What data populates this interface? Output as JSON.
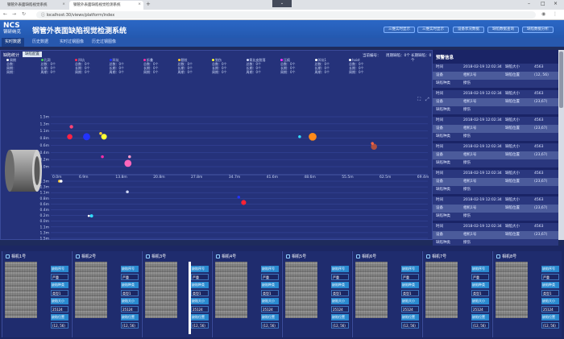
{
  "browser": {
    "tabs": [
      {
        "title": "钢管外表面缺陷视觉系统",
        "active": false
      },
      {
        "title": "钢管外表面缺陷视觉检测系统",
        "active": true
      }
    ],
    "url": "localhost:30/views/platform/index"
  },
  "app": {
    "logo_main": "NCS",
    "logo_sub": "钢研纳克",
    "title": "钢管外表面缺陷视觉检测系统",
    "header_buttons": [
      "三维实时显示",
      "三维实时显示",
      "设备状况数据",
      "缺陷数据查询",
      "缺陷数据分析"
    ]
  },
  "subnav": [
    "实时数据",
    "历史数据",
    "实时过钢图像",
    "历史过钢图像"
  ],
  "main_panel": {
    "title": "缺陷统计",
    "tab_label": "缺陷配置",
    "right_info": [
      "当前编号：",
      "周期缺陷：0个",
      "长期缺陷：0个"
    ],
    "categories": [
      {
        "name": "周期",
        "color": "#ffffff",
        "lines": [
          "总数：",
          "周期：",
          "周期："
        ]
      },
      {
        "name": "孔洞",
        "color": "#3fcf55",
        "lines": [
          "总数：0个",
          "长期：0个",
          "周期：0个"
        ]
      },
      {
        "name": "凹坑",
        "color": "#ff2d55",
        "lines": [
          "总数：0个",
          "长期：0个",
          "周期：0个"
        ]
      },
      {
        "name": "凹坑",
        "color": "#2233ff",
        "lines": [
          "总数：0个",
          "长期：0个",
          "周期：0个"
        ]
      },
      {
        "name": "折叠",
        "color": "#ff2da8",
        "lines": [
          "总数：0个",
          "长期：0个",
          "周期：0个"
        ]
      },
      {
        "name": "裂纹",
        "color": "#ffcc33",
        "lines": [
          "总数：0个",
          "长期：0个",
          "周期：0个"
        ]
      },
      {
        "name": "划伤",
        "color": "#ffff33",
        "lines": [
          "总数：0个",
          "长期：0个",
          "周期：0个"
        ]
      },
      {
        "name": "氧化皮脱落",
        "color": "#cfd7f5",
        "lines": [
          "总数：0个",
          "长期：0个",
          "周期：0个"
        ]
      },
      {
        "name": "压痕",
        "color": "#ff2dff",
        "lines": [
          "总数：0个",
          "长期：0个",
          "周期：0个"
        ]
      },
      {
        "name": "凹坑1",
        "color": "#ffffff",
        "lines": [
          "总数：0个",
          "长期：0个",
          "周期：0个"
        ]
      },
      {
        "name": "hoist",
        "color": "#ffffff",
        "lines": [
          "总数：0个",
          "长期：0个",
          "周期：0个"
        ]
      }
    ]
  },
  "chart_data": {
    "type": "scatter",
    "xlabel": "",
    "ylabel": "",
    "x_ticks": [
      "6.9m",
      "13.8m",
      "20.8m",
      "27.8m",
      "34.7m",
      "41.6m",
      "48.6m",
      "55.5m",
      "62.5m",
      "69.4m"
    ],
    "x_start_label": "0.0m",
    "y_ticks_top": [
      "1.5m",
      "1.3m",
      "1.1m",
      "0.8m",
      "0.6m",
      "0.4m",
      "0.2m",
      "0.0m"
    ],
    "y_ticks_bottom": [
      "1.5m",
      "1.3m",
      "1.1m",
      "0.8m",
      "0.6m",
      "0.4m",
      "0.2m",
      "0.0m",
      "1.1m",
      "1.3m",
      "1.5m"
    ],
    "xlim": [
      0,
      69.4
    ],
    "series": [
      {
        "panel": "top",
        "x": 3.5,
        "y": 0.9,
        "size": 1.5,
        "color": "#ff2244"
      },
      {
        "panel": "top",
        "x": 3.8,
        "y": 1.2,
        "size": 1,
        "color": "#ff4477"
      },
      {
        "panel": "top",
        "x": 6.6,
        "y": 0.9,
        "size": 2,
        "color": "#2233ff"
      },
      {
        "panel": "top",
        "x": 9.8,
        "y": 0.9,
        "size": 1.6,
        "color": "#ffff33"
      },
      {
        "panel": "top",
        "x": 9.2,
        "y": 1.0,
        "size": 0.8,
        "color": "#ffcc33"
      },
      {
        "panel": "top",
        "x": 9.5,
        "y": 0.3,
        "size": 0.8,
        "color": "#ff2da8"
      },
      {
        "panel": "top",
        "x": 14.2,
        "y": 0.1,
        "size": 2,
        "color": "#ff66bb"
      },
      {
        "panel": "top",
        "x": 14.5,
        "y": 0.3,
        "size": 0.8,
        "color": "#ff99cc"
      },
      {
        "panel": "top",
        "x": 45.8,
        "y": 0.9,
        "size": 0.8,
        "color": "#33ddff"
      },
      {
        "panel": "top",
        "x": 48.2,
        "y": 0.9,
        "size": 2.2,
        "color": "#ff8a1a"
      },
      {
        "panel": "top",
        "x": 59.5,
        "y": 0.6,
        "size": 1.7,
        "color": "#b05040"
      },
      {
        "panel": "top",
        "x": 59.2,
        "y": 0.7,
        "size": 0.8,
        "color": "#ff6644"
      },
      {
        "panel": "bottom",
        "x": 1.6,
        "y": 1.5,
        "size": 0.8,
        "color": "#ffcc33"
      },
      {
        "panel": "bottom",
        "x": 1.9,
        "y": 1.5,
        "size": 0.8,
        "color": "#ffffff"
      },
      {
        "panel": "bottom",
        "x": 14.1,
        "y": 1.1,
        "size": 0.8,
        "color": "#cfd7f5"
      },
      {
        "panel": "bottom",
        "x": 7.5,
        "y": 0.2,
        "size": 0.9,
        "color": "#33ddff"
      },
      {
        "panel": "bottom",
        "x": 7.0,
        "y": 0.2,
        "size": 0.6,
        "color": "#ffffff"
      },
      {
        "panel": "bottom",
        "x": 35.5,
        "y": 0.7,
        "size": 1.4,
        "color": "#ff2233"
      },
      {
        "panel": "bottom",
        "x": 34.6,
        "y": 0.9,
        "size": 0.8,
        "color": "#2233ff"
      }
    ]
  },
  "side_panel": {
    "title": "预警信息",
    "records": [
      {
        "time_label": "时间",
        "time": "2018-02-19 12:02:34",
        "size_label": "缺陷大小",
        "size": "4563",
        "dev_label": "设备",
        "dev": "相机1号",
        "pos_label": "缺陷位置",
        "pos": "(12, 56)",
        "type_label": "缺陷种类",
        "type": "擦伤"
      },
      {
        "time_label": "时间",
        "time": "2018-02-19 12:02:34",
        "size_label": "缺陷大小",
        "size": "4563",
        "dev_label": "设备",
        "dev": "相机1号",
        "pos_label": "缺陷位置",
        "pos": "(23,67)",
        "type_label": "缺陷种类",
        "type": "擦伤"
      },
      {
        "time_label": "时间",
        "time": "2018-02-19 12:02:34",
        "size_label": "缺陷大小",
        "size": "4563",
        "dev_label": "设备",
        "dev": "相机1号",
        "pos_label": "缺陷位置",
        "pos": "(23,67)",
        "type_label": "缺陷种类",
        "type": "擦伤"
      },
      {
        "time_label": "时间",
        "time": "2018-02-19 12:02:34",
        "size_label": "缺陷大小",
        "size": "4563",
        "dev_label": "设备",
        "dev": "相机1号",
        "pos_label": "缺陷位置",
        "pos": "(23,67)",
        "type_label": "缺陷种类",
        "type": "擦伤"
      },
      {
        "time_label": "时间",
        "time": "2018-02-19 12:02:34",
        "size_label": "缺陷大小",
        "size": "4563",
        "dev_label": "设备",
        "dev": "相机1号",
        "pos_label": "缺陷位置",
        "pos": "(23,67)",
        "type_label": "缺陷种类",
        "type": "擦伤"
      },
      {
        "time_label": "时间",
        "time": "2018-02-19 12:02:34",
        "size_label": "缺陷大小",
        "size": "4563",
        "dev_label": "设备",
        "dev": "相机1号",
        "pos_label": "缺陷位置",
        "pos": "(23,67)",
        "type_label": "缺陷种类",
        "type": "擦伤"
      },
      {
        "time_label": "时间",
        "time": "2018-02-19 12:02:34",
        "size_label": "缺陷大小",
        "size": "4563",
        "dev_label": "设备",
        "dev": "相机1号",
        "pos_label": "缺陷位置",
        "pos": "(23,67)",
        "type_label": "缺陷种类",
        "type": "擦伤"
      }
    ]
  },
  "cameras": [
    {
      "title": "相机1号",
      "labels": [
        "缺陷序号",
        "严重",
        "缺陷种类",
        "类型1",
        "缺陷大小",
        "25124",
        "缺陷位置",
        "(12, 56)"
      ]
    },
    {
      "title": "相机2号",
      "labels": [
        "缺陷序号",
        "严重",
        "缺陷种类",
        "类型1",
        "缺陷大小",
        "25124",
        "缺陷位置",
        "(12, 56)"
      ]
    },
    {
      "title": "相机3号",
      "labels": [
        "缺陷序号",
        "严重",
        "缺陷种类",
        "类型1",
        "缺陷大小",
        "25124",
        "缺陷位置",
        "(12, 56)"
      ]
    },
    {
      "title": "相机4号",
      "labels": [
        "缺陷序号",
        "严重",
        "缺陷种类",
        "类型1",
        "缺陷大小",
        "25124",
        "缺陷位置",
        "(12, 56)"
      ]
    },
    {
      "title": "相机5号",
      "labels": [
        "缺陷序号",
        "严重",
        "缺陷种类",
        "类型1",
        "缺陷大小",
        "25124",
        "缺陷位置",
        "(12, 56)"
      ]
    },
    {
      "title": "相机6号",
      "labels": [
        "缺陷序号",
        "严重",
        "缺陷种类",
        "类型1",
        "缺陷大小",
        "25124",
        "缺陷位置",
        "(12, 56)"
      ]
    },
    {
      "title": "相机7号",
      "labels": [
        "缺陷序号",
        "严重",
        "缺陷种类",
        "类型1",
        "缺陷大小",
        "25124",
        "缺陷位置",
        "(12, 56)"
      ]
    },
    {
      "title": "相机8号",
      "labels": [
        "缺陷序号",
        "严重",
        "缺陷种类",
        "类型1",
        "缺陷大小",
        "25124",
        "缺陷位置",
        "(12, 56)"
      ]
    }
  ]
}
